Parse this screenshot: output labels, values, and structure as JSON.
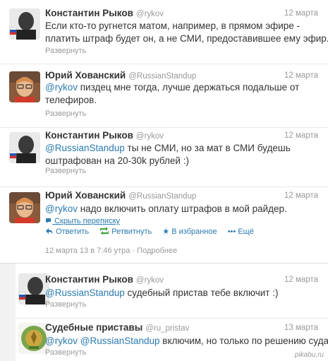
{
  "tweets": [
    {
      "name": "Константин Рыков",
      "handle": "@rykov",
      "date": "12 марта",
      "text1": "Если кто-то ругнется матом, например, в прямом эфире -",
      "text2": "платить штраф будет он, а не СМИ, предоставившее ему эфир..",
      "expand": "Развернуть"
    },
    {
      "name": "Юрий Хованский",
      "handle": "@RussianStandup",
      "date": "12 марта",
      "mention": "@rykov",
      "text1": " пиздец мне тогда, лучше держаться подальше от",
      "text2": "телефиров.",
      "expand": "Развернуть"
    },
    {
      "name": "Константин Рыков",
      "handle": "@rykov",
      "date": "12 марта",
      "mention": "@RussianStandup",
      "text1": " ты не СМИ, но за мат в СМИ будешь",
      "text2": "оштрафован на 20-30k рублей :)",
      "expand": "Развернуть"
    },
    {
      "name": "Юрий Хованский",
      "handle": "@RussianStandup",
      "date": "12 марта",
      "mention": "@rykov",
      "text1": " надо включить оплату штрафов в мой райдер.",
      "convo": "Скрыть переписку",
      "actions": {
        "reply": "Ответить",
        "retweet": "Ретвитнуть",
        "favorite": "В избранное",
        "more": "Ещё"
      },
      "meta_date": "12 марта 13 в 7:46 утра",
      "meta_sep": " · ",
      "meta_details": "Подробнее"
    },
    {
      "name": "Константин Рыков",
      "handle": "@rykov",
      "date": "12 марта",
      "mention": "@RussianStandup",
      "text1": " судебный пристав тебе включит :)",
      "expand": "Развернуть"
    },
    {
      "name": "Судебные приставы",
      "handle": "@ru_pristav",
      "date": "13 марта",
      "mention": "@rykov",
      "mention2": "@RussianStandup",
      "text1": " включим, но только по решению суда",
      "expand": "Развернуть"
    }
  ],
  "watermark": "pikabu.ru",
  "colors": {
    "link": "#2a7ab0",
    "muted": "#999999",
    "text": "#333333"
  }
}
